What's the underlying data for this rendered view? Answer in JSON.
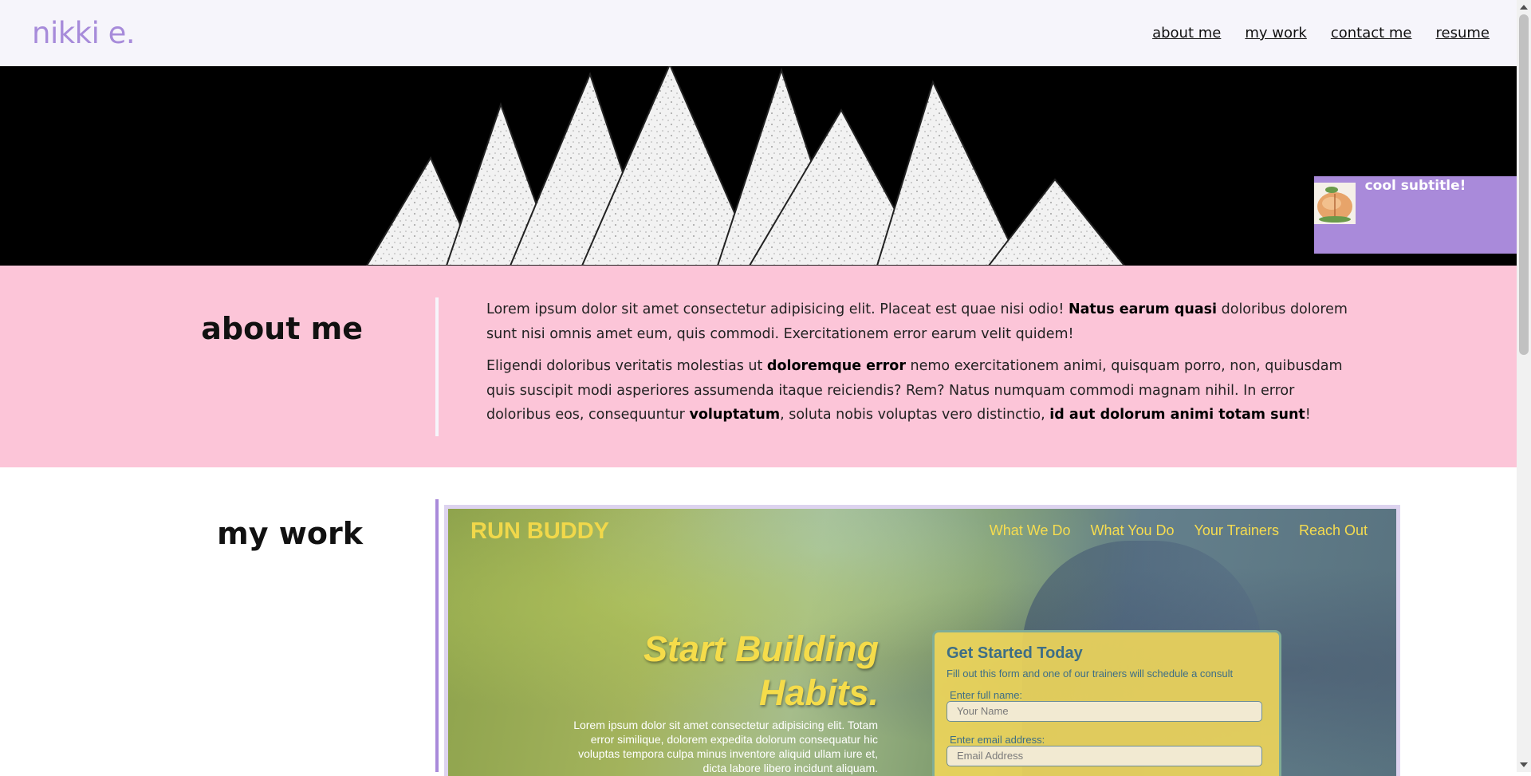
{
  "header": {
    "brand": "nikki e.",
    "nav": [
      "about me",
      "my work",
      "contact me",
      "resume"
    ]
  },
  "hero": {
    "subtitle": "cool subtitle!",
    "badge_icon": "peach-icon"
  },
  "about": {
    "title": "about me",
    "p1": [
      "Lorem ipsum dolor sit amet consectetur adipisicing elit. Placeat est quae nisi odio! ",
      "Natus earum quasi",
      " doloribus dolorem sunt nisi omnis amet eum, quis commodi. Exercitationem error earum velit quidem!"
    ],
    "p2": [
      "Eligendi doloribus veritatis molestias ut ",
      "doloremque error",
      " nemo exercitationem animi, quisquam porro, non, quibusdam quis suscipit modi asperiores assumenda itaque reiciendis? Rem? Natus numquam commodi magnam nihil. In error doloribus eos, consequuntur ",
      "voluptatum",
      ", soluta nobis voluptas vero distinctio, ",
      "id aut dolorum animi totam sunt",
      "!"
    ]
  },
  "work": {
    "title": "my work",
    "project": {
      "brand": "RUN BUDDY",
      "nav": [
        "What We Do",
        "What You Do",
        "Your Trainers",
        "Reach Out"
      ],
      "headline": "Start Building Habits.",
      "lorem": "Lorem ipsum dolor sit amet consectetur adipisicing elit. Totam error similique, dolorem expedita dolorum consequatur hic voluptas tempora culpa minus inventore aliquid ullam iure et, dicta labore libero incidunt aliquam.",
      "form": {
        "title": "Get Started Today",
        "subtitle": "Fill out this form and one of our trainers will schedule a consult",
        "name_label": "Enter full name:",
        "name_placeholder": "Your Name",
        "email_label": "Enter email address:",
        "email_placeholder": "Email Address"
      }
    }
  },
  "colors": {
    "accent": "#a98ada",
    "about_bg": "#fcc5d8",
    "header_bg": "#f6f5fb",
    "project_yellow": "#f5dc4a"
  }
}
